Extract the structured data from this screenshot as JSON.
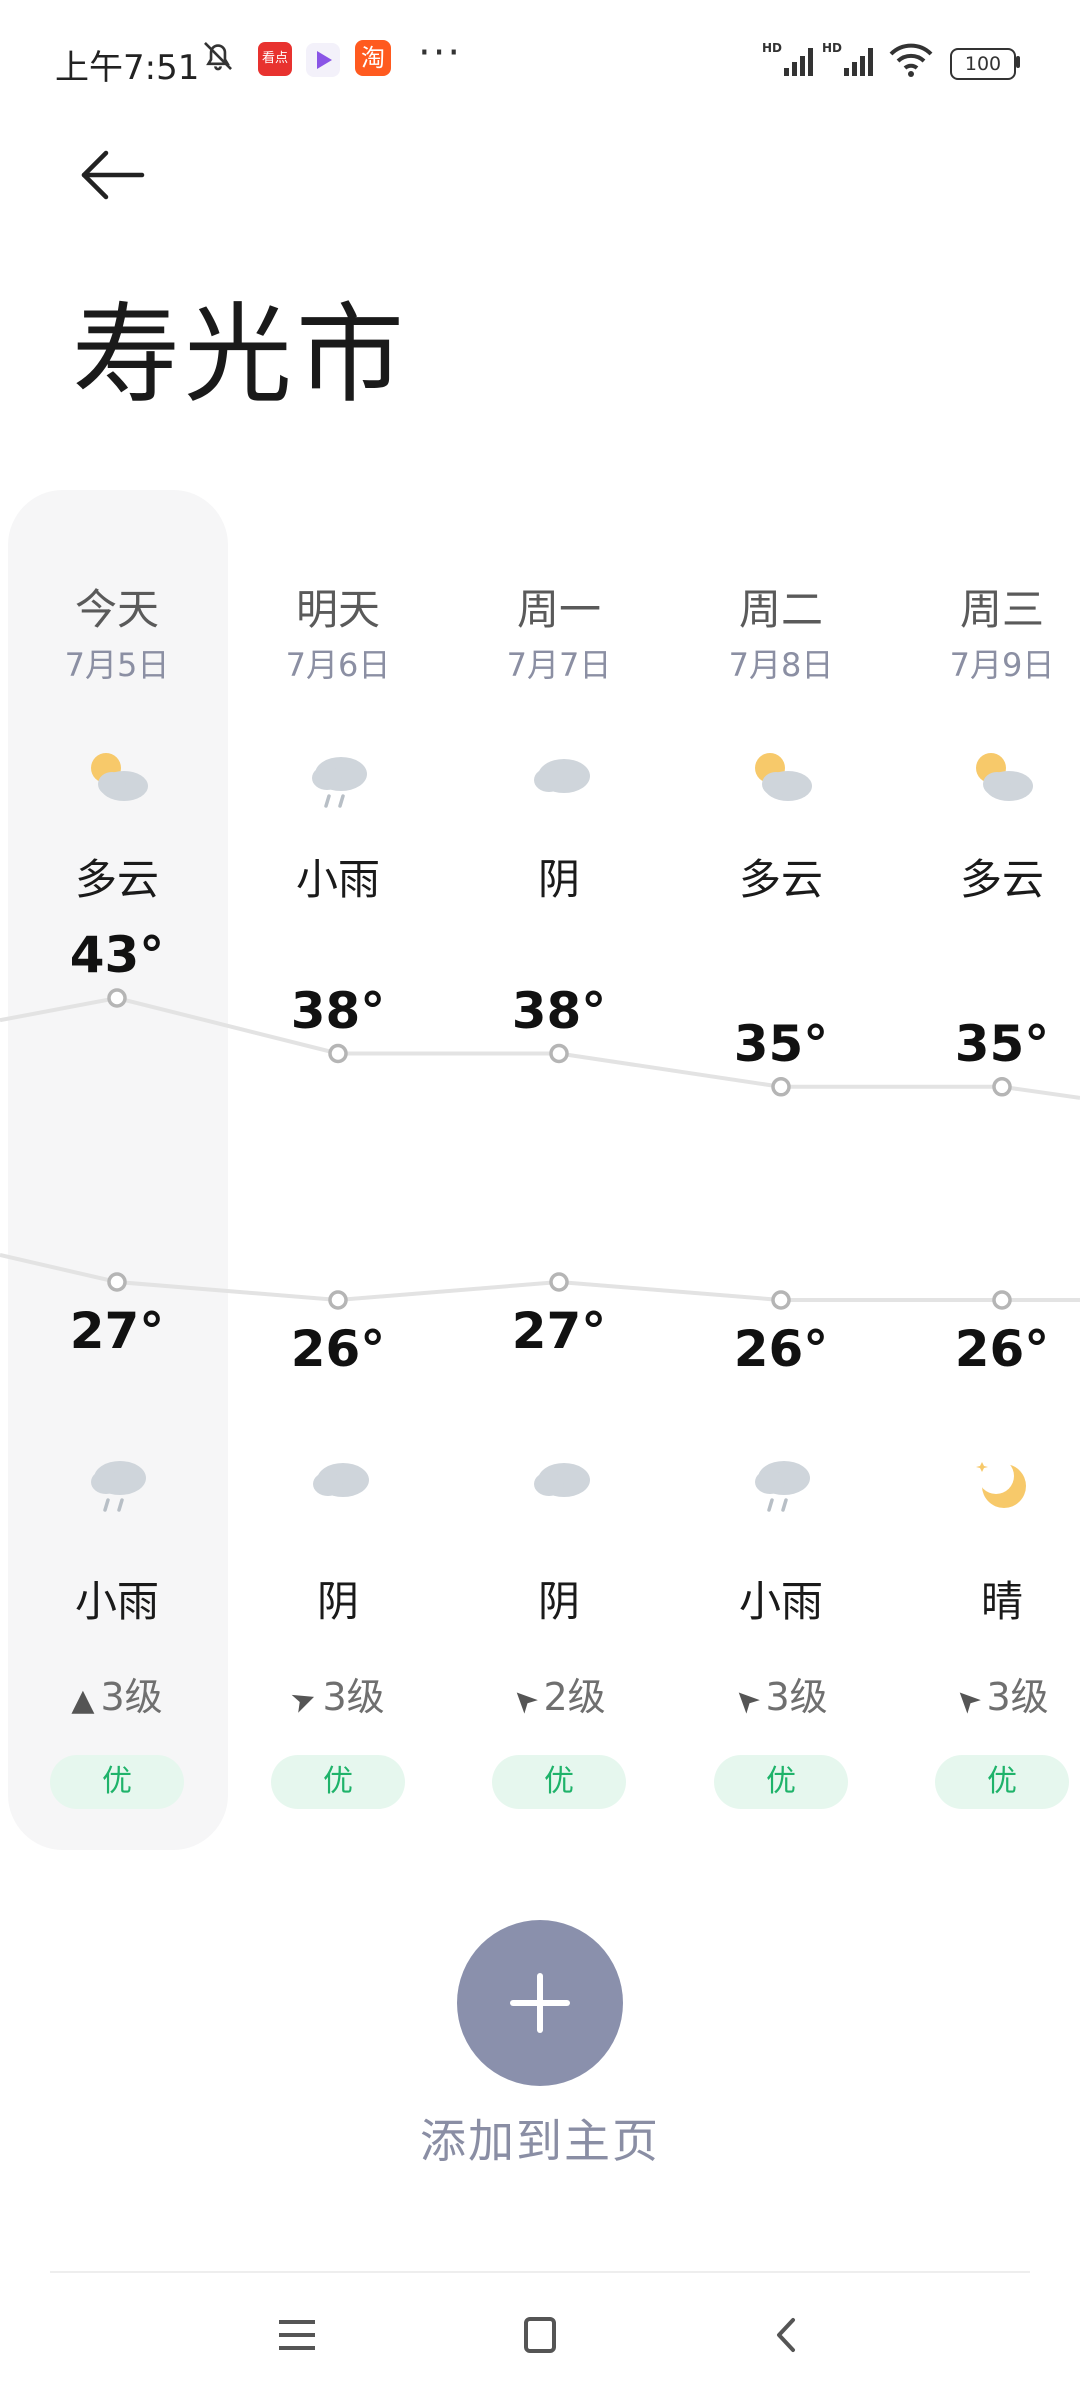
{
  "status_bar": {
    "time": "上午7:51",
    "battery": "100",
    "app_badges": [
      "看点",
      "淘"
    ],
    "network": [
      "HD",
      "HD"
    ]
  },
  "header": {
    "city": "寿光市"
  },
  "forecast": [
    {
      "day": "今天",
      "date": "7月5日",
      "day_condition": "多云",
      "day_icon": "partly-cloudy-icon",
      "high": "43°",
      "low": "27°",
      "night_icon": "rain-icon",
      "night_condition": "小雨",
      "wind": "3级",
      "wind_arrow": "▲",
      "aqi": "优",
      "high_value": 43,
      "low_value": 27
    },
    {
      "day": "明天",
      "date": "7月6日",
      "day_condition": "小雨",
      "day_icon": "rain-icon",
      "high": "38°",
      "low": "26°",
      "night_icon": "cloudy-icon",
      "night_condition": "阴",
      "wind": "3级",
      "wind_arrow": "➤",
      "aqi": "优",
      "high_value": 38,
      "low_value": 26
    },
    {
      "day": "周一",
      "date": "7月7日",
      "day_condition": "阴",
      "day_icon": "cloudy-icon",
      "high": "38°",
      "low": "27°",
      "night_icon": "cloudy-icon",
      "night_condition": "阴",
      "wind": "2级",
      "wind_arrow": "➤",
      "aqi": "优",
      "high_value": 38,
      "low_value": 27
    },
    {
      "day": "周二",
      "date": "7月8日",
      "day_condition": "多云",
      "day_icon": "partly-cloudy-icon",
      "high": "35°",
      "low": "26°",
      "night_icon": "rain-icon",
      "night_condition": "小雨",
      "wind": "3级",
      "wind_arrow": "➤",
      "aqi": "优",
      "high_value": 35,
      "low_value": 26
    },
    {
      "day": "周三",
      "date": "7月9日",
      "day_condition": "多云",
      "day_icon": "partly-cloudy-icon",
      "high": "35°",
      "low": "26°",
      "night_icon": "moon-icon",
      "night_condition": "晴",
      "wind": "3级",
      "wind_arrow": "➤",
      "aqi": "优",
      "high_value": 35,
      "low_value": 26
    }
  ],
  "actions": {
    "add_to_home": "添加到主页"
  },
  "colors": {
    "accent_button": "#8a90ac",
    "aqi_green": "#1fb36a",
    "aqi_bg": "#e6f7ee",
    "line": "#e3e3e3"
  },
  "nav": {
    "icons": [
      "menu-icon",
      "home-icon",
      "back-icon"
    ]
  }
}
